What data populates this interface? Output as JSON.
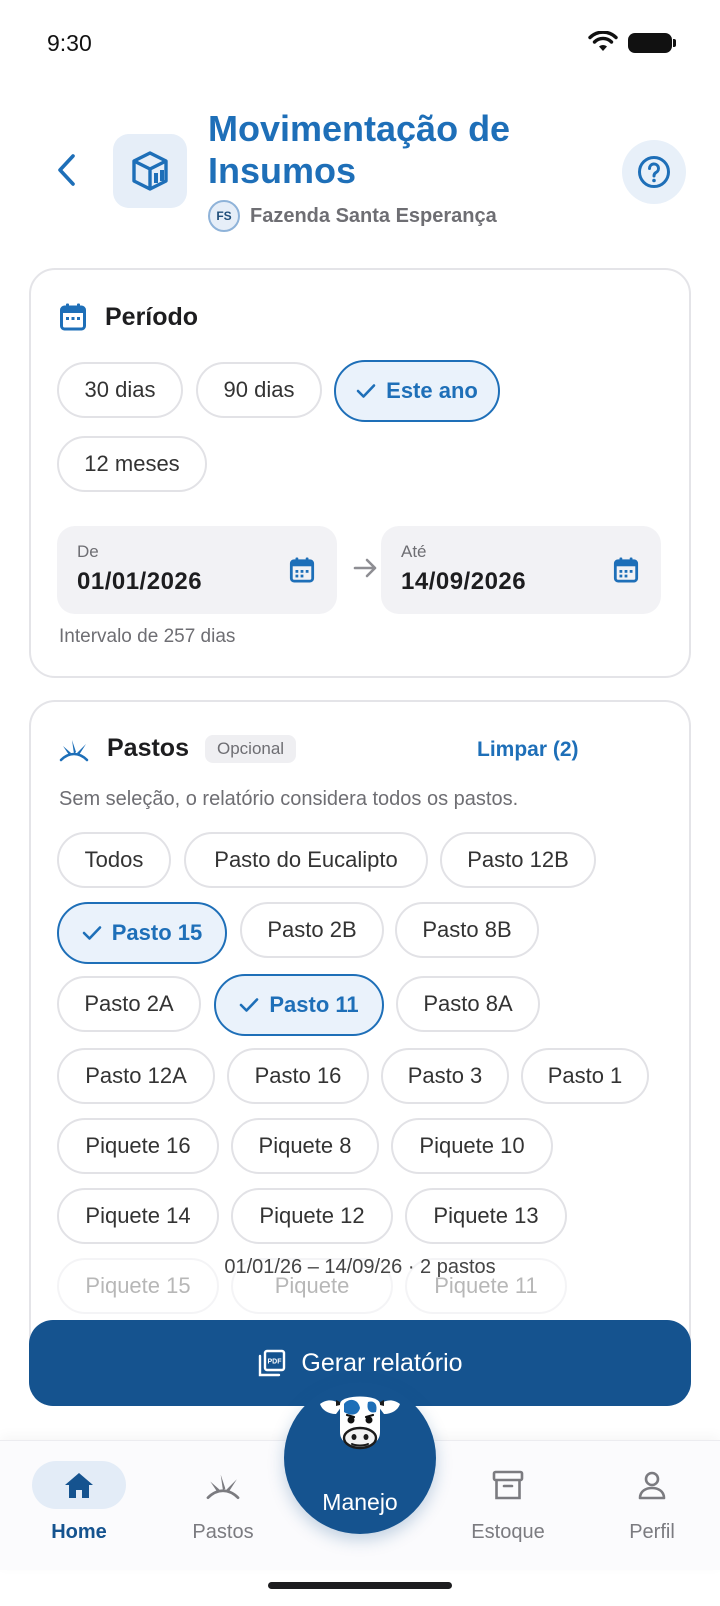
{
  "status_bar": {
    "time": "9:30"
  },
  "header": {
    "title": "Movimentação de Insumos",
    "farm_initials": "FS",
    "farm_name": "Fazenda Santa Esperança"
  },
  "periodo": {
    "title": "Período",
    "presets": [
      {
        "label": "30 dias",
        "selected": false
      },
      {
        "label": "90 dias",
        "selected": false
      },
      {
        "label": "Este ano",
        "selected": true
      },
      {
        "label": "12 meses",
        "selected": false
      }
    ],
    "from_label": "De",
    "from_value": "01/01/2026",
    "to_label": "Até",
    "to_value": "14/09/2026",
    "interval_text": "Intervalo de 257 dias"
  },
  "pastos": {
    "title": "Pastos",
    "optional_badge": "Opcional",
    "clear_label": "Limpar (2)",
    "description": "Sem seleção, o relatório considera todos os pastos.",
    "chips": [
      {
        "label": "Todos",
        "selected": false
      },
      {
        "label": "Pasto do Eucalipto",
        "selected": false
      },
      {
        "label": "Pasto 12B",
        "selected": false
      },
      {
        "label": "Pasto 15",
        "selected": true
      },
      {
        "label": "Pasto 2B",
        "selected": false
      },
      {
        "label": "Pasto 8B",
        "selected": false
      },
      {
        "label": "Pasto 2A",
        "selected": false
      },
      {
        "label": "Pasto 11",
        "selected": true
      },
      {
        "label": "Pasto 8A",
        "selected": false
      },
      {
        "label": "Pasto 12A",
        "selected": false
      },
      {
        "label": "Pasto 16",
        "selected": false
      },
      {
        "label": "Pasto 3",
        "selected": false
      },
      {
        "label": "Pasto 1",
        "selected": false
      },
      {
        "label": "Piquete 16",
        "selected": false
      },
      {
        "label": "Piquete 8",
        "selected": false
      },
      {
        "label": "Piquete 10",
        "selected": false
      },
      {
        "label": "Piquete 14",
        "selected": false
      },
      {
        "label": "Piquete 12",
        "selected": false
      },
      {
        "label": "Piquete 13",
        "selected": false
      },
      {
        "label": "Piquete 15",
        "selected": false
      },
      {
        "label": "Piquete",
        "selected": false
      },
      {
        "label": "Piquete 11",
        "selected": false
      }
    ]
  },
  "summary": "01/01/26 – 14/09/26 · 2 pastos",
  "generate_button": "Gerar relatório",
  "bottom_nav": {
    "home": "Home",
    "pastos": "Pastos",
    "manejo": "Manejo",
    "estoque": "Estoque",
    "perfil": "Perfil"
  },
  "colors": {
    "primary": "#1e6fb8",
    "primary_dark": "#15538f",
    "chip_selected_bg": "#eaf2fb",
    "muted_text": "#6e6e73"
  }
}
